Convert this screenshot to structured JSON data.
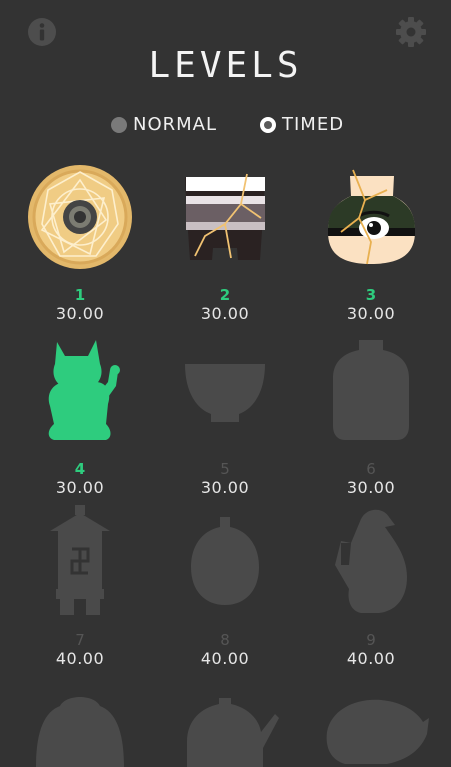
{
  "header": {
    "title": "LEVELS"
  },
  "modes": {
    "normal": "NORMAL",
    "timed": "TIMED",
    "selected": "timed"
  },
  "colors": {
    "background": "#333333",
    "unlocked": "#2ecc7e",
    "locked_silhouette": "#4a4a4a"
  },
  "levels": [
    {
      "number": "1",
      "time": "30.00",
      "state": "completed",
      "icon": "ornate-plate"
    },
    {
      "number": "2",
      "time": "30.00",
      "state": "completed",
      "icon": "striped-bowl"
    },
    {
      "number": "3",
      "time": "30.00",
      "state": "completed",
      "icon": "eye-vase"
    },
    {
      "number": "4",
      "time": "30.00",
      "state": "unlocked",
      "icon": "lucky-cat"
    },
    {
      "number": "5",
      "time": "30.00",
      "state": "locked",
      "icon": "bowl-silhouette"
    },
    {
      "number": "6",
      "time": "30.00",
      "state": "locked",
      "icon": "jar-silhouette"
    },
    {
      "number": "7",
      "time": "40.00",
      "state": "locked",
      "icon": "lantern-silhouette"
    },
    {
      "number": "8",
      "time": "40.00",
      "state": "locked",
      "icon": "pumpkin-silhouette"
    },
    {
      "number": "9",
      "time": "40.00",
      "state": "locked",
      "icon": "penguin-silhouette"
    }
  ]
}
